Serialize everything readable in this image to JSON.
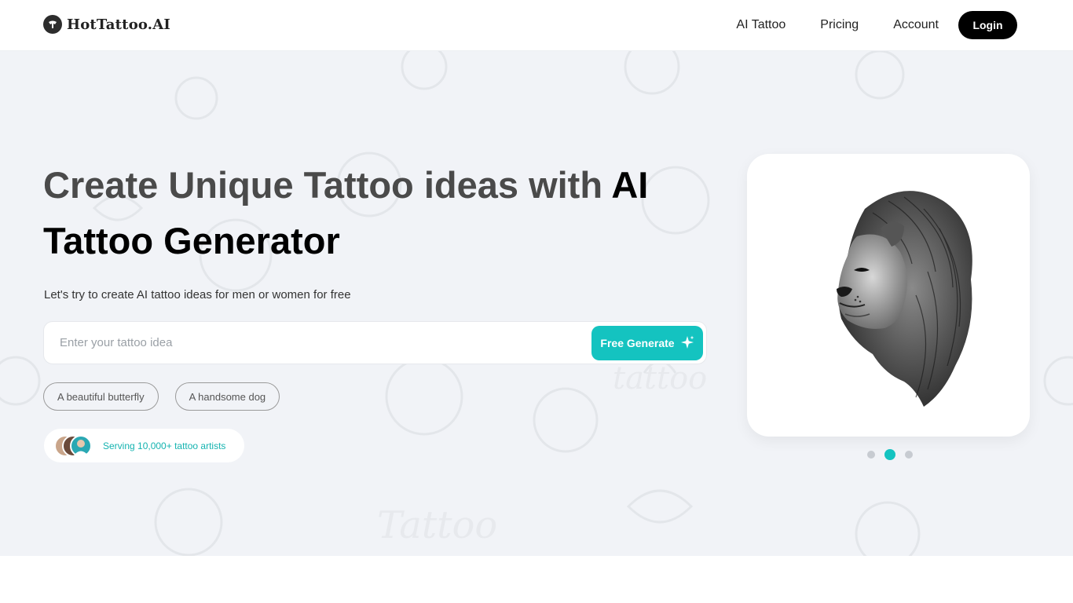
{
  "brand": {
    "name": "HotTattoo.AI",
    "logo_icon": "tattoo-machine-icon"
  },
  "nav": {
    "items": [
      {
        "label": "AI Tattoo"
      },
      {
        "label": "Pricing"
      },
      {
        "label": "Account"
      }
    ],
    "login_label": "Login"
  },
  "hero": {
    "title_part1": "Create Unique Tattoo ideas with ",
    "title_part2": "AI Tattoo Generator",
    "subtitle": "Let's try to create AI tattoo ideas for men or women for free",
    "search": {
      "placeholder": "Enter your tattoo idea",
      "value": ""
    },
    "generate_label": "Free Generate",
    "generate_icon": "sparkle-icon",
    "suggestions": [
      "A beautiful butterfly",
      "A handsome dog"
    ],
    "serving_text": "Serving 10,000+ tattoo artists"
  },
  "carousel": {
    "image": "lion-tattoo-image",
    "slide_count": 3,
    "active_slide": 2
  },
  "colors": {
    "accent": "#14c3c0",
    "hero_bg": "#f1f3f7",
    "login_bg": "#000000"
  }
}
